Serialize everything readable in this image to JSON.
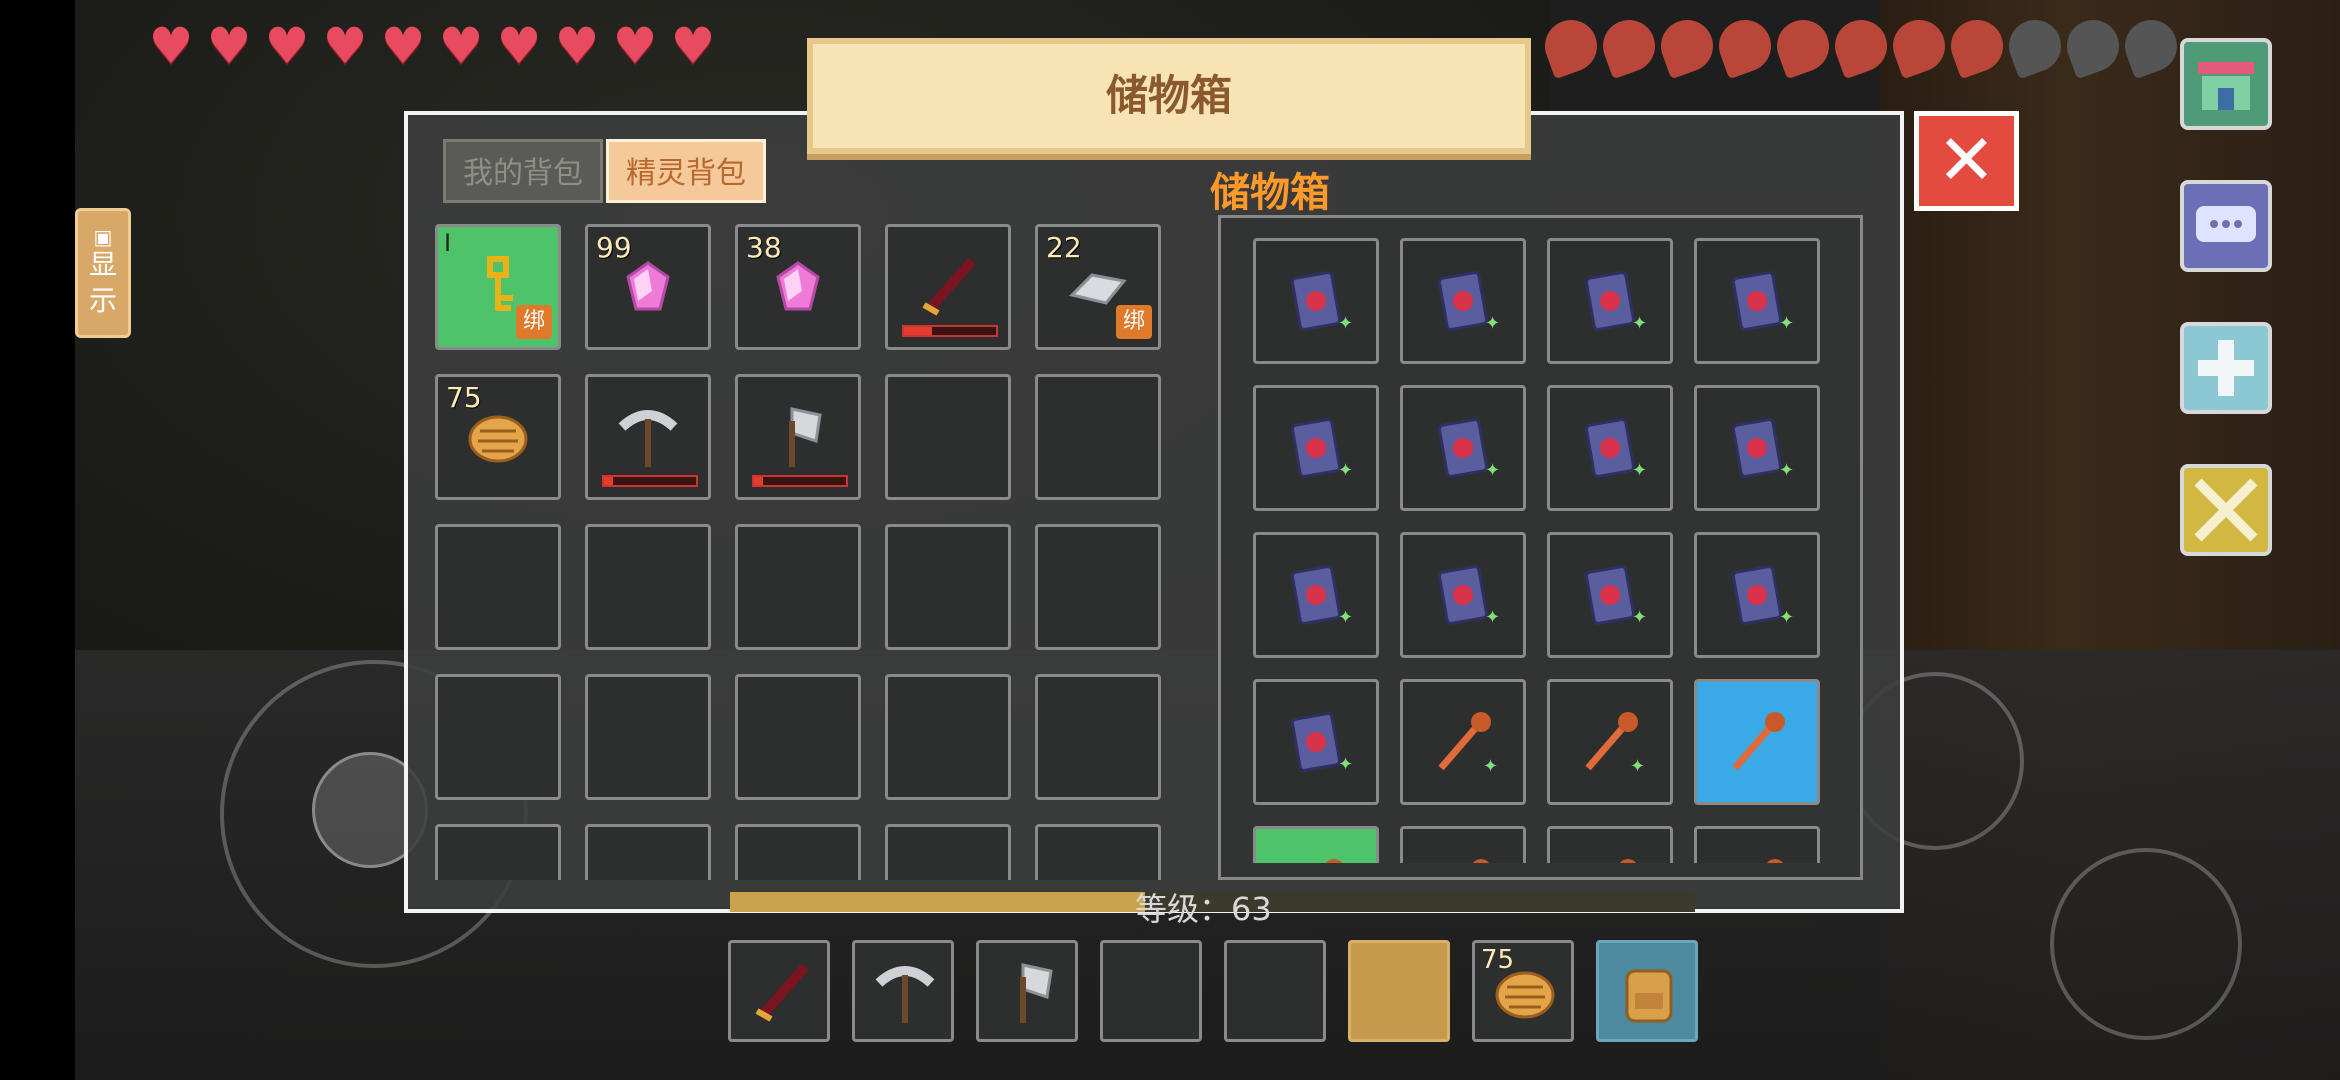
{
  "hud": {
    "hearts": 10,
    "food_full": 8,
    "food_empty": 3
  },
  "window": {
    "title": "储物箱",
    "tabs": [
      {
        "label": "我的背包",
        "active": false
      },
      {
        "label": "精灵背包",
        "active": true
      }
    ],
    "close_label": "✕"
  },
  "show_button": {
    "label_line1": "显",
    "label_line2": "示"
  },
  "storage": {
    "title": "储物箱"
  },
  "player_slots": [
    {
      "item": "gold-key",
      "badge": "绑",
      "roman": "I",
      "bg": "green",
      "count": ""
    },
    {
      "item": "pink-gem",
      "count": "99"
    },
    {
      "item": "pink-gem",
      "count": "38"
    },
    {
      "item": "dark-sword",
      "count": "",
      "durability": 0.3
    },
    {
      "item": "silver-ingot",
      "count": "22",
      "badge": "绑"
    },
    {
      "item": "bread-loaf",
      "count": "75"
    },
    {
      "item": "iron-pickaxe",
      "count": "",
      "durability": 0.1
    },
    {
      "item": "iron-axe",
      "count": "",
      "durability": 0.1
    }
  ],
  "storage_slots": [
    "spell-book",
    "spell-book",
    "spell-book",
    "spell-book",
    "spell-book",
    "spell-book",
    "spell-book",
    "spell-book",
    "spell-book",
    "spell-book",
    "spell-book",
    "spell-book",
    "spell-book",
    "magic-staff",
    "magic-staff",
    "magic-staff-blue"
  ],
  "level": {
    "text": "等级：63",
    "progress": 0.43
  },
  "hotbar": [
    {
      "item": "dark-sword",
      "count": ""
    },
    {
      "item": "iron-pickaxe",
      "count": ""
    },
    {
      "item": "iron-axe",
      "count": ""
    },
    {
      "item": "",
      "count": ""
    },
    {
      "item": "",
      "count": ""
    },
    {
      "item": "",
      "count": "",
      "selected": true
    },
    {
      "item": "bread-loaf",
      "count": "75"
    },
    {
      "item": "backpack",
      "count": ""
    }
  ],
  "side_buttons": [
    "shop-icon",
    "chat-icon",
    "plus-icon",
    "crossed-swords-icon"
  ],
  "colors": {
    "accent_orange": "#ff9a2a",
    "close_red": "#e34b3f",
    "heart": "#e84a5f"
  }
}
